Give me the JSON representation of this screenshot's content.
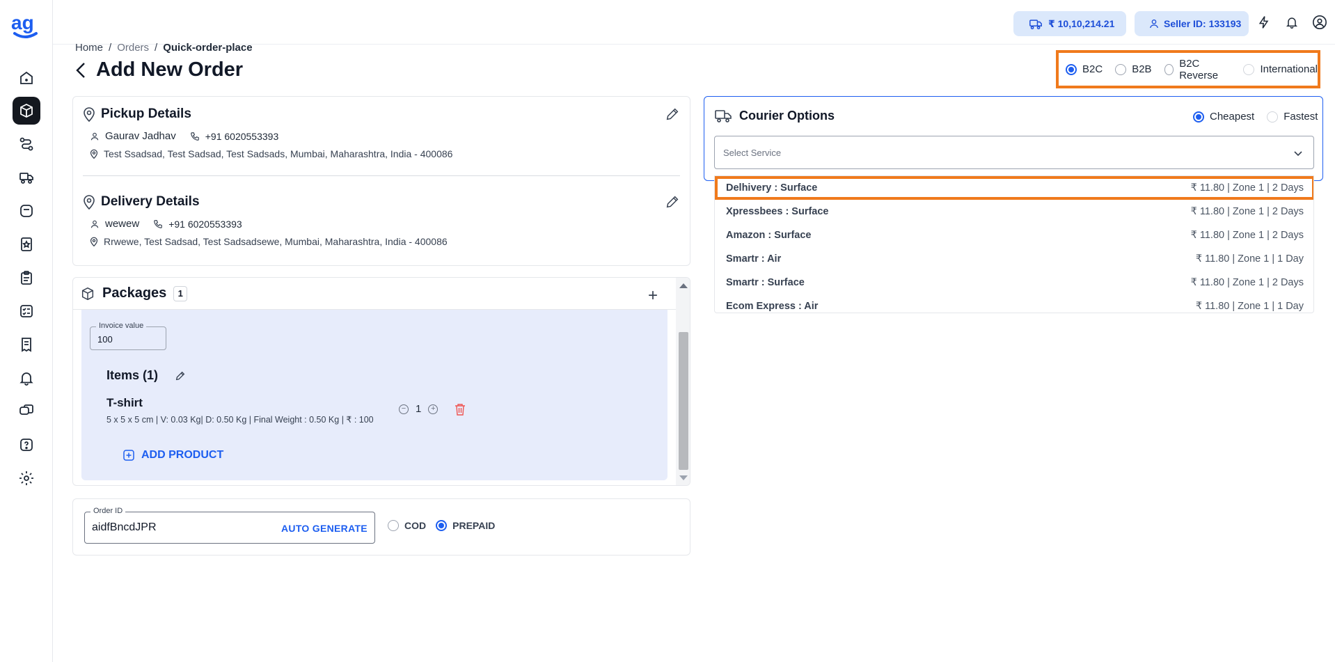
{
  "topbar": {
    "wallet": "₹ 10,10,214.21",
    "seller": "Seller ID: 133193"
  },
  "breadcrumb": {
    "home": "Home",
    "sep": "/",
    "orders": "Orders",
    "current": "Quick-order-place"
  },
  "page": {
    "title": "Add New Order"
  },
  "order_type": {
    "selected": "B2C",
    "options": [
      "B2C",
      "B2B",
      "B2C Reverse",
      "International"
    ]
  },
  "pickup": {
    "title": "Pickup Details",
    "name": "Gaurav Jadhav",
    "phone": "+91 6020553393",
    "address": "Test Ssadsad, Test Sadsad, Test Sadsads, Mumbai, Maharashtra, India - 400086"
  },
  "delivery": {
    "title": "Delivery Details",
    "name": "wewew",
    "phone": "+91 6020553393",
    "address": "Rrwewe, Test Sadsad, Test Sadsadsewe, Mumbai, Maharashtra, India - 400086"
  },
  "packages": {
    "title": "Packages",
    "count": "1",
    "invoice_label": "Invoice value",
    "invoice_value": "100",
    "items_title": "Items (1)",
    "item": {
      "name": "T-shirt",
      "meta": "5 x 5 x 5 cm | V: 0.03 Kg| D: 0.50 Kg | Final Weight : 0.50 Kg | ₹ : 100",
      "qty": "1"
    },
    "add_product": "ADD PRODUCT"
  },
  "order": {
    "id_label": "Order ID",
    "id_value": "aidfBncdJPR",
    "auto_generate": "AUTO GENERATE",
    "payment": {
      "selected": "PREPAID",
      "options": [
        "COD",
        "PREPAID"
      ]
    }
  },
  "courier": {
    "title": "Courier Options",
    "sort": {
      "selected": "Cheapest",
      "options": [
        "Cheapest",
        "Fastest"
      ]
    },
    "select_placeholder": "Select Service",
    "options": [
      {
        "name": "Delhivery : Surface",
        "meta": "₹ 11.80 | Zone 1 | 2 Days"
      },
      {
        "name": "Xpressbees : Surface",
        "meta": "₹ 11.80 | Zone 1 | 2 Days"
      },
      {
        "name": "Amazon : Surface",
        "meta": "₹ 11.80 | Zone 1 | 2 Days"
      },
      {
        "name": "Smartr : Air",
        "meta": "₹ 11.80 | Zone 1 | 1 Day"
      },
      {
        "name": "Smartr : Surface",
        "meta": "₹ 11.80 | Zone 1 | 2 Days"
      },
      {
        "name": "Ecom Express : Air",
        "meta": "₹ 11.80 | Zone 1 | 1 Day"
      }
    ]
  },
  "sidebar": {
    "icons": [
      "home-icon",
      "package-icon",
      "route-icon",
      "truck-icon",
      "weight-icon",
      "star-badge-icon",
      "clipboard-icon",
      "checklist-icon",
      "receipt-icon",
      "bell-icon",
      "chat-icon",
      "help-icon",
      "gear-icon"
    ]
  },
  "colors": {
    "accent": "#1d5ef0",
    "highlight": "#f07a1c",
    "active_nav": "#14181f"
  }
}
